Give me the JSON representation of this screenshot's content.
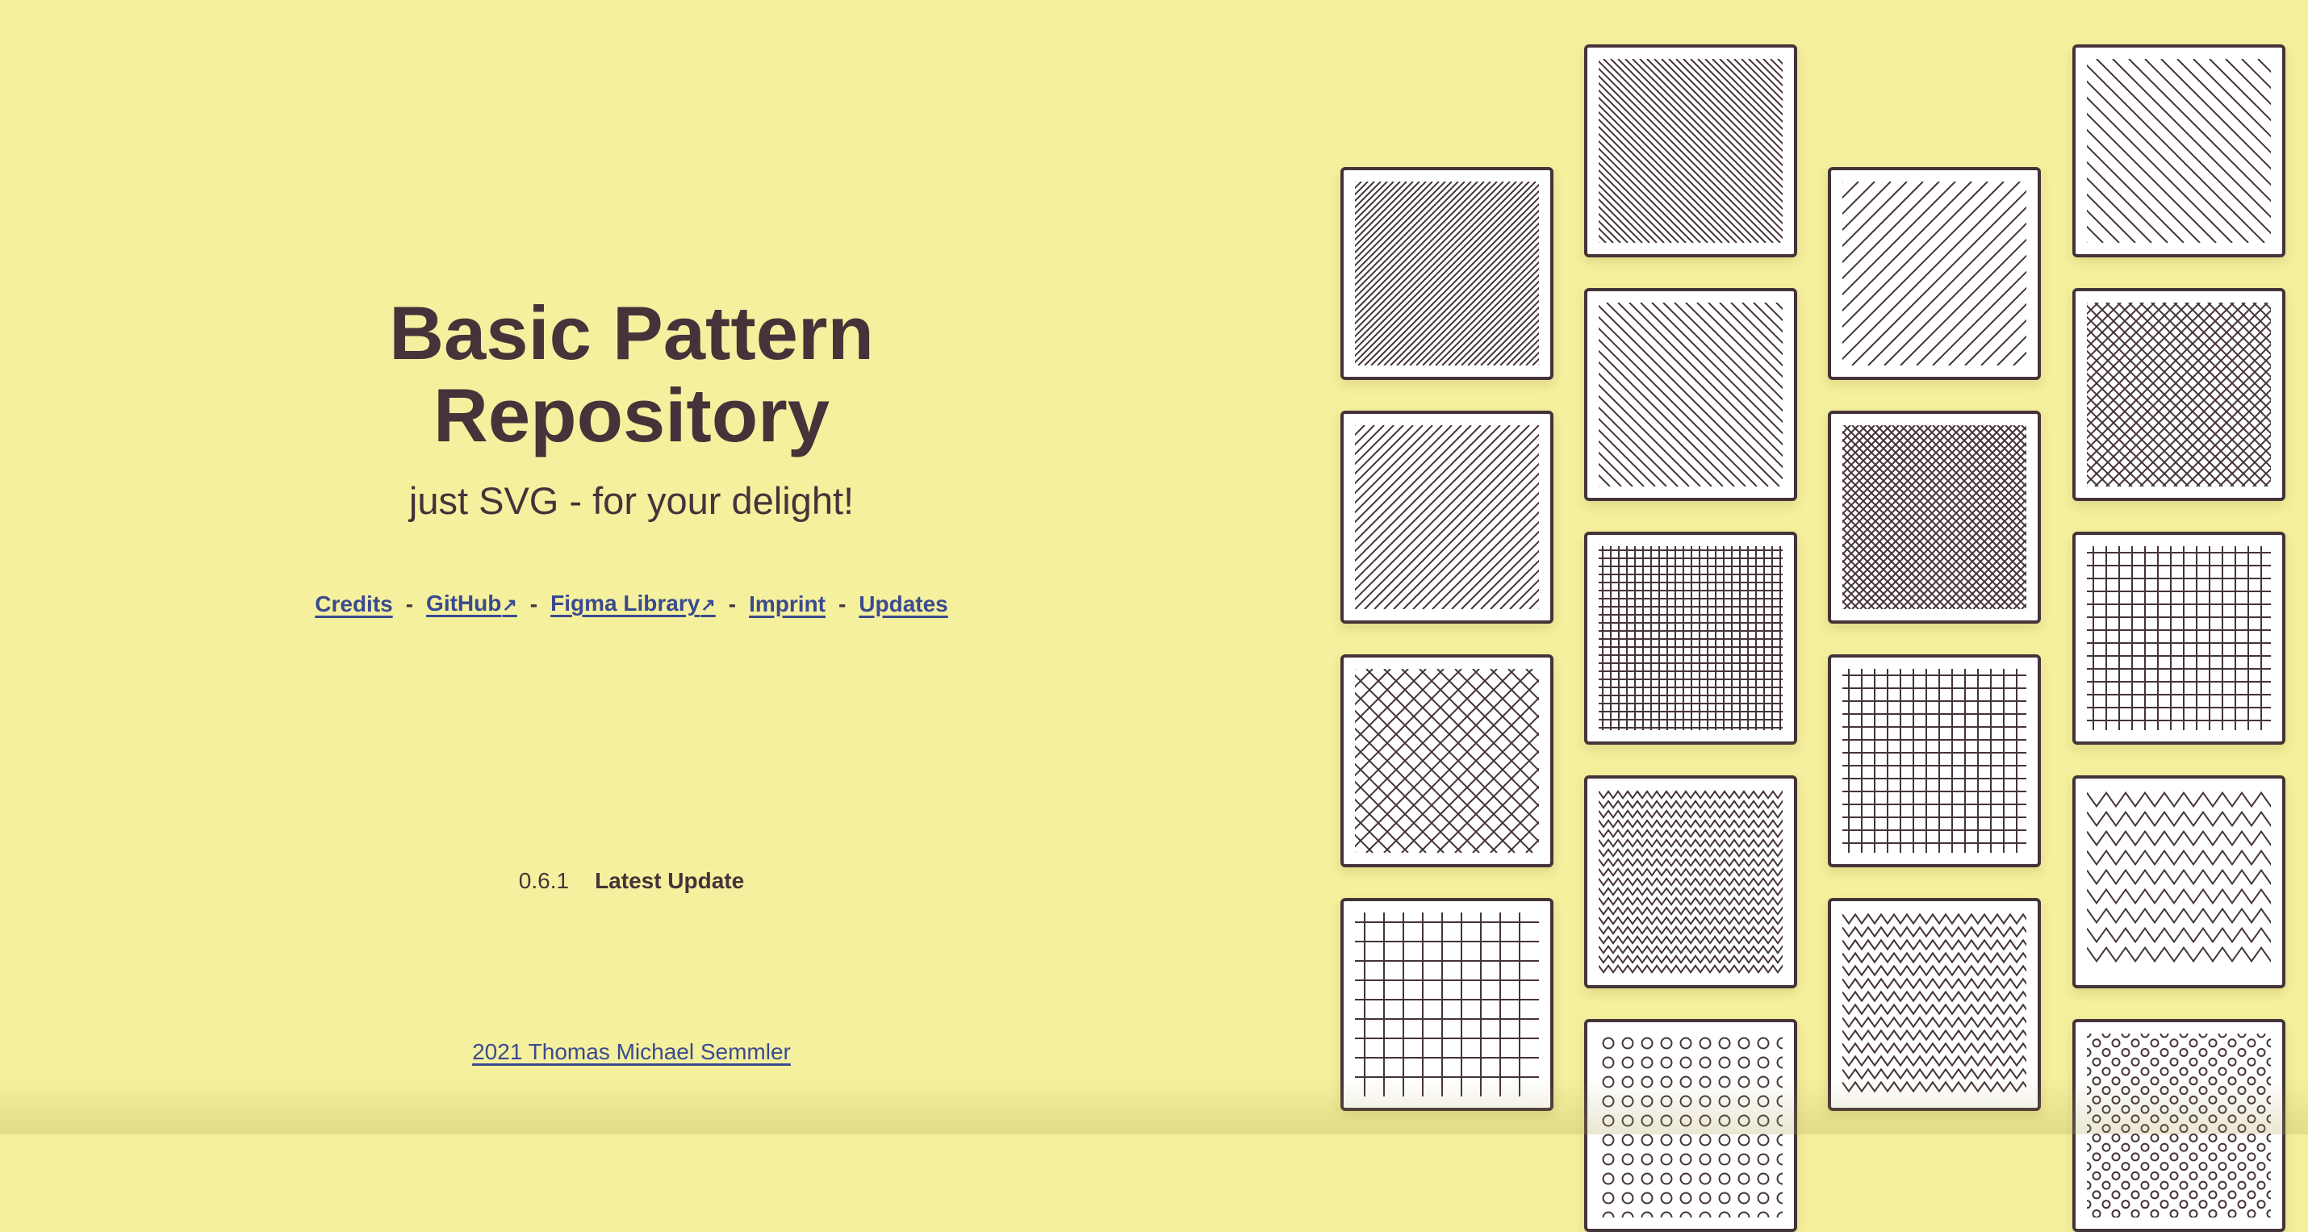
{
  "header": {
    "title_line1": "Basic Pattern",
    "title_line2": "Repository",
    "subtitle": "just SVG - for your delight!"
  },
  "nav": {
    "separator": "-",
    "external_icon": "↗",
    "links": [
      {
        "label": "Credits",
        "external": false
      },
      {
        "label": "GitHub",
        "external": true
      },
      {
        "label": "Figma Library",
        "external": true
      },
      {
        "label": "Imprint",
        "external": false
      },
      {
        "label": "Updates",
        "external": false
      }
    ]
  },
  "version": {
    "number": "0.6.1",
    "label": "Latest Update"
  },
  "footer": {
    "credit": "2021 Thomas Michael Semmler"
  },
  "colors": {
    "background": "#f5f09e",
    "text": "#45333a",
    "link": "#3a4a8f",
    "tile_bg": "#ffffff",
    "pattern_stroke": "#45333a"
  },
  "patterns": [
    {
      "column": 1,
      "type": "lines-up",
      "density": "dense"
    },
    {
      "column": 1,
      "type": "lines-up",
      "density": "medium"
    },
    {
      "column": 1,
      "type": "diamonds",
      "density": "sparse"
    },
    {
      "column": 1,
      "type": "grid",
      "density": "sparse"
    },
    {
      "column": 2,
      "type": "lines-down",
      "density": "dense"
    },
    {
      "column": 2,
      "type": "lines-down",
      "density": "medium"
    },
    {
      "column": 2,
      "type": "grid",
      "density": "dense"
    },
    {
      "column": 2,
      "type": "zigzag",
      "density": "dense"
    },
    {
      "column": 2,
      "type": "circles",
      "density": "medium"
    },
    {
      "column": 3,
      "type": "lines-up",
      "density": "sparse"
    },
    {
      "column": 3,
      "type": "diamonds",
      "density": "dense"
    },
    {
      "column": 3,
      "type": "grid",
      "density": "medium"
    },
    {
      "column": 3,
      "type": "zigzag",
      "density": "medium"
    },
    {
      "column": 4,
      "type": "lines-down",
      "density": "sparse"
    },
    {
      "column": 4,
      "type": "diamonds",
      "density": "medium"
    },
    {
      "column": 4,
      "type": "grid",
      "density": "medium"
    },
    {
      "column": 4,
      "type": "zigzag",
      "density": "sparse"
    },
    {
      "column": 4,
      "type": "dots-staggered",
      "density": "dense"
    }
  ]
}
